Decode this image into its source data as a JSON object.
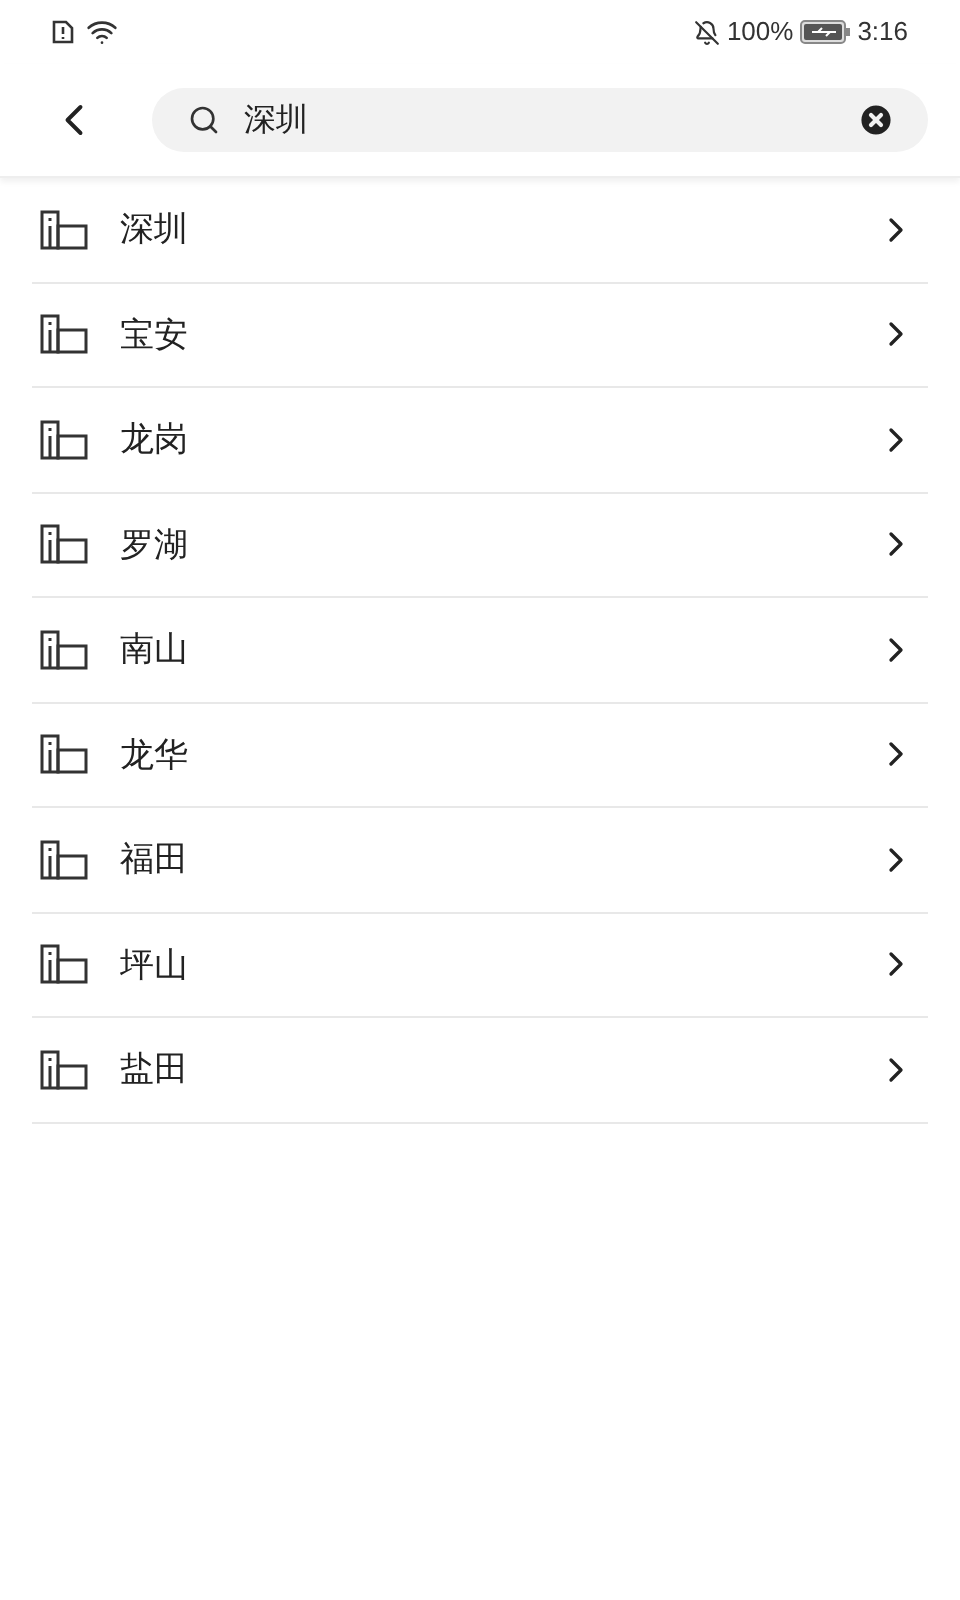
{
  "status_bar": {
    "battery": "100%",
    "time": "3:16"
  },
  "search": {
    "value": "深圳"
  },
  "districts": [
    {
      "name": "深圳"
    },
    {
      "name": "宝安"
    },
    {
      "name": "龙岗"
    },
    {
      "name": "罗湖"
    },
    {
      "name": "南山"
    },
    {
      "name": "龙华"
    },
    {
      "name": "福田"
    },
    {
      "name": "坪山"
    },
    {
      "name": "盐田"
    }
  ]
}
